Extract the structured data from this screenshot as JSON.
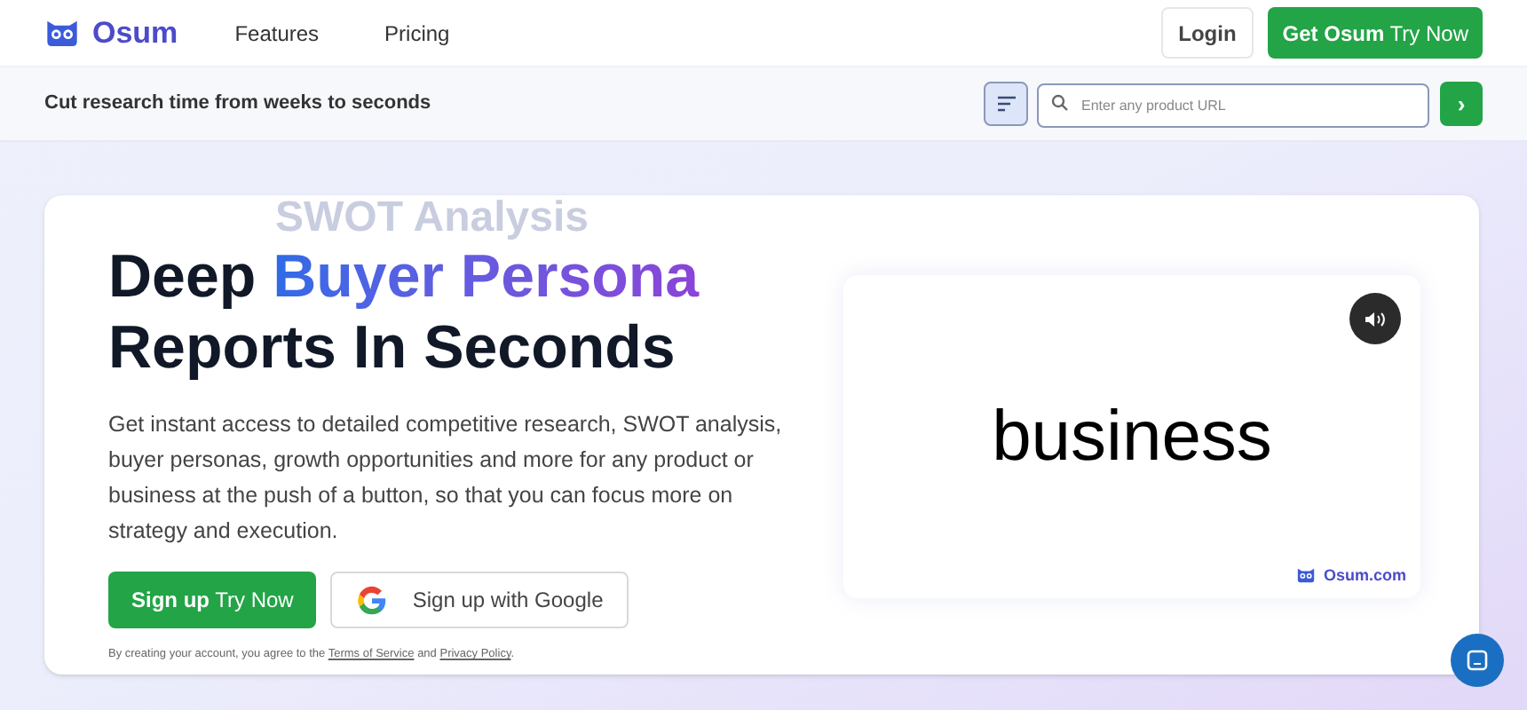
{
  "nav": {
    "brand": "Osum",
    "links": [
      "Features",
      "Pricing"
    ],
    "login": "Login",
    "cta": "**Get Osum** Try Now"
  },
  "subbar": {
    "tagline": "Cut research time from weeks to seconds",
    "search": {
      "placeholder": "Enter any product URL"
    },
    "go": "›"
  },
  "hero": {
    "ghost": "SWOT Analysis",
    "headline": {
      "lead": "Deep",
      "highlight": "Buyer Persona",
      "rest": "Reports In Seconds"
    },
    "description": "Get instant access to detailed competitive research, SWOT analysis, buyer personas, growth opportunities and more for any product or business at the push of a button, so that you can focus more on strategy and execution.",
    "signup": "**Sign up** Try Now",
    "google": "Sign up with Google",
    "legal": {
      "before": "By creating your account, you agree to the",
      "terms": "Terms of Service",
      "and": "and",
      "privacy": "Privacy Policy",
      "end": "."
    }
  },
  "video": {
    "word": "business",
    "watermark": "Osum.com"
  }
}
